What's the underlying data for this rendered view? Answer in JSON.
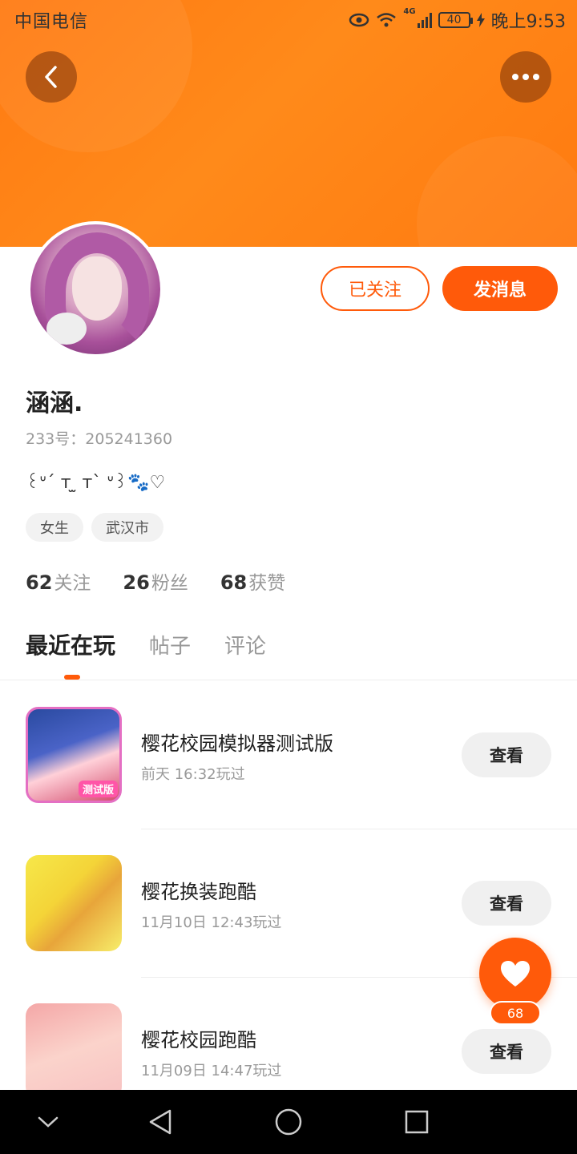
{
  "status": {
    "carrier": "中国电信",
    "network": "4G",
    "battery": "40",
    "time": "晚上9:53"
  },
  "header": {
    "back_icon": "chevron-left-icon",
    "more_icon": "more-horizontal-icon"
  },
  "profile": {
    "follow_label": "已关注",
    "message_label": "发消息",
    "username": "涵涵.",
    "user_id": "233号：205241360",
    "signature": "꒰ᐡˊ ᴛ ̫ ᴛˋ ᐡ꒱🐾♡",
    "tags": [
      "女生",
      "武汉市"
    ],
    "stats": [
      {
        "num": "62",
        "label": "关注"
      },
      {
        "num": "26",
        "label": "粉丝"
      },
      {
        "num": "68",
        "label": "获赞"
      }
    ]
  },
  "tabs": [
    "最近在玩",
    "帖子",
    "评论"
  ],
  "games": [
    {
      "name": "樱花校园模拟器测试版",
      "time": "前天 16:32玩过",
      "button": "查看",
      "badge": "测试版"
    },
    {
      "name": "樱花换装跑酷",
      "time": "11月10日 12:43玩过",
      "button": "查看"
    },
    {
      "name": "樱花校园跑酷",
      "time": "11月09日 14:47玩过",
      "button": "查看"
    }
  ],
  "like": {
    "count": "68",
    "icon": "heart-icon"
  },
  "colors": {
    "accent": "#ff5a0a",
    "banner": "#ff7a12"
  }
}
